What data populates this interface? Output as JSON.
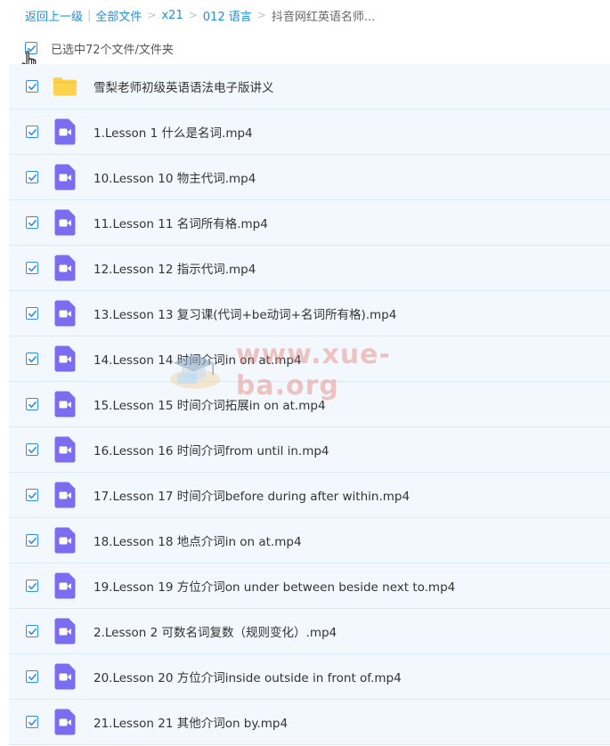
{
  "colors": {
    "link": "#1f8fd6",
    "checkbox": "#2d8cf0",
    "row_bg": "#f3f8fe",
    "folder": "#fdd24d",
    "video_icon": "#7b6cf0"
  },
  "breadcrumb": {
    "back": "返回上一级",
    "items": [
      "全部文件",
      "x21",
      "012 语言"
    ],
    "current": "抖音网红英语名师..."
  },
  "selection": {
    "text": "已选中72个文件/文件夹",
    "checked": true
  },
  "files": [
    {
      "name": "雪梨老师初级英语语法电子版讲义",
      "type": "folder",
      "icon": "folder-icon",
      "checked": true
    },
    {
      "name": "1.Lesson 1 什么是名词.mp4",
      "type": "video",
      "icon": "video-icon",
      "checked": true
    },
    {
      "name": "10.Lesson 10 物主代词.mp4",
      "type": "video",
      "icon": "video-icon",
      "checked": true
    },
    {
      "name": "11.Lesson 11 名词所有格.mp4",
      "type": "video",
      "icon": "video-icon",
      "checked": true
    },
    {
      "name": "12.Lesson 12 指示代词.mp4",
      "type": "video",
      "icon": "video-icon",
      "checked": true
    },
    {
      "name": "13.Lesson 13 复习课(代词+be动词+名词所有格).mp4",
      "type": "video",
      "icon": "video-icon",
      "checked": true
    },
    {
      "name": "14.Lesson 14 时间介词in on at.mp4",
      "type": "video",
      "icon": "video-icon",
      "checked": true
    },
    {
      "name": "15.Lesson 15 时间介词拓展in on at.mp4",
      "type": "video",
      "icon": "video-icon",
      "checked": true
    },
    {
      "name": "16.Lesson 16 时间介词from until in.mp4",
      "type": "video",
      "icon": "video-icon",
      "checked": true
    },
    {
      "name": "17.Lesson 17 时间介词before during after within.mp4",
      "type": "video",
      "icon": "video-icon",
      "checked": true
    },
    {
      "name": "18.Lesson 18 地点介词in on at.mp4",
      "type": "video",
      "icon": "video-icon",
      "checked": true
    },
    {
      "name": "19.Lesson 19 方位介词on under between beside next to.mp4",
      "type": "video",
      "icon": "video-icon",
      "checked": true
    },
    {
      "name": "2.Lesson 2 可数名词复数（规则变化）.mp4",
      "type": "video",
      "icon": "video-icon",
      "checked": true
    },
    {
      "name": "20.Lesson 20 方位介词inside outside in front of.mp4",
      "type": "video",
      "icon": "video-icon",
      "checked": true
    },
    {
      "name": "21.Lesson 21 其他介词on by.mp4",
      "type": "video",
      "icon": "video-icon",
      "checked": true
    }
  ],
  "watermark": {
    "text": "www.xue-ba.org",
    "icon": "graduation-cap-icon"
  }
}
